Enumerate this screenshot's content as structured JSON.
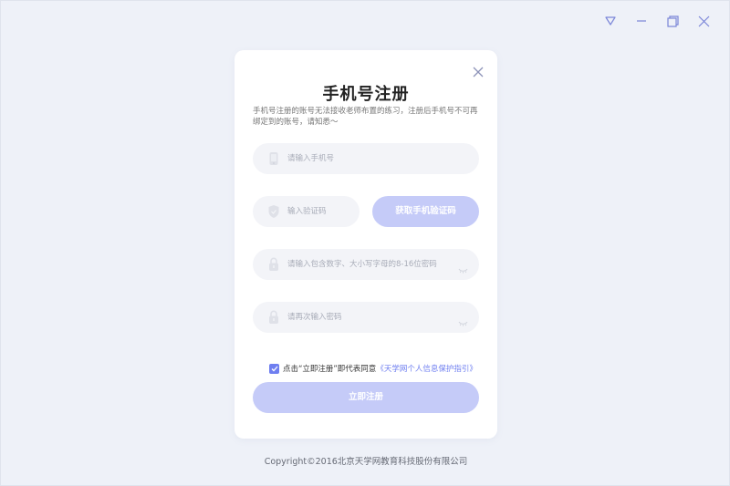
{
  "window": {
    "controls": [
      "dropdown-icon",
      "minimize-icon",
      "restore-icon",
      "close-icon"
    ]
  },
  "card": {
    "title": "手机号注册",
    "notice": "手机号注册的账号无法接收老师布置的练习，注册后手机号不可再绑定到的账号，请知悉～",
    "phone": {
      "placeholder": "请输入手机号",
      "icon": "phone-icon"
    },
    "code": {
      "placeholder": "输入验证码",
      "icon": "shield-icon",
      "button_label": "获取手机验证码"
    },
    "password": {
      "placeholder": "请输入包含数字、大小写字母的8-16位密码",
      "icon": "lock-icon"
    },
    "password_confirm": {
      "placeholder": "请再次输入密码",
      "icon": "lock-icon"
    },
    "agreement": {
      "checked": true,
      "text": "点击“立即注册”即代表同意",
      "link": "《天学网个人信息保护指引》"
    },
    "submit_label": "立即注册"
  },
  "footer": {
    "copyright": "Copyright©2016北京天学网教育科技股份有限公司"
  },
  "colors": {
    "background": "#eef1f8",
    "accent": "#6f7ff0",
    "button_disabled": "#c5cbf8",
    "field_bg": "#f3f4f8"
  }
}
